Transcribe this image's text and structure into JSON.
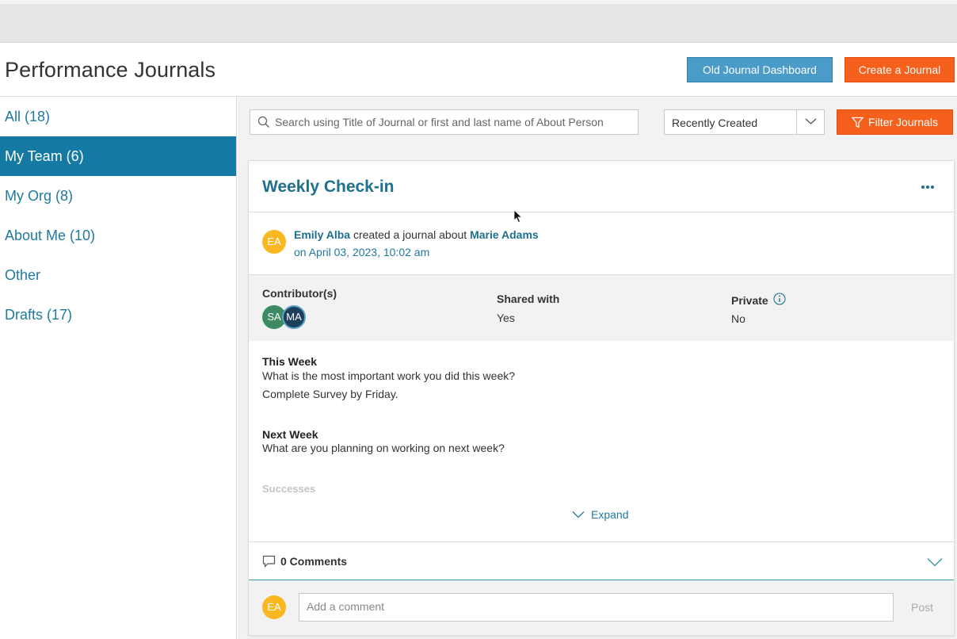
{
  "header": {
    "title": "Performance Journals",
    "old_dashboard_label": "Old Journal Dashboard",
    "create_label": "Create a Journal"
  },
  "sidebar": {
    "items": [
      {
        "label": "All (18)"
      },
      {
        "label": "My Team (6)"
      },
      {
        "label": "My Org (8)"
      },
      {
        "label": "About Me (10)"
      },
      {
        "label": "Other"
      },
      {
        "label": "Drafts (17)"
      }
    ],
    "active_index": 1
  },
  "toolbar": {
    "search_placeholder": "Search using Title of Journal or first and last name of About Person",
    "sort_value": "Recently Created",
    "filter_label": "Filter Journals"
  },
  "journal": {
    "title": "Weekly Check-in",
    "author": "Emily Alba",
    "action_text": " created a journal about ",
    "subject": "Marie Adams",
    "date": "on April 03, 2023, 10:02 am",
    "author_initials": "EA",
    "contributors_label": "Contributor(s)",
    "contributors": [
      "SA",
      "MA"
    ],
    "shared_label": "Shared with",
    "shared_value": "Yes",
    "private_label": "Private",
    "private_value": "No",
    "sections": [
      {
        "title": "This Week",
        "question": "What is the most important work you did this week?",
        "answer": "Complete Survey by Friday."
      },
      {
        "title": "Next Week",
        "question": "What are you planning on working on next week?"
      }
    ],
    "faded_section": "Successes",
    "expand_label": "Expand",
    "comments_label": "0 Comments",
    "comment_placeholder": "Add a comment",
    "post_label": "Post",
    "commenter_initials": "EA"
  },
  "colors": {
    "accent_blue": "#157aa3",
    "link_blue": "#1f6f8f",
    "orange": "#f5601c",
    "old_btn_blue": "#4a9bc8"
  }
}
